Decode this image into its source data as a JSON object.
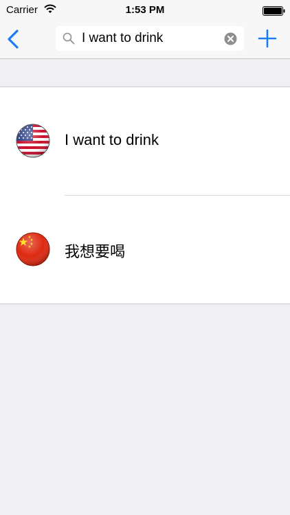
{
  "status_bar": {
    "carrier": "Carrier",
    "time": "1:53 PM",
    "wifi_icon": "wifi-icon",
    "battery_icon": "battery-icon"
  },
  "nav_bar": {
    "back_icon": "chevron-left-icon",
    "search": {
      "icon": "search-icon",
      "value": "I want to drink",
      "clear_icon": "clear-icon"
    },
    "add_icon": "plus-icon"
  },
  "phrases": [
    {
      "flag_icon": "us-flag-icon",
      "text": "I want to drink"
    },
    {
      "flag_icon": "china-flag-icon",
      "text": "我想要喝"
    }
  ],
  "colors": {
    "accent": "#1a7cf5",
    "background": "#efeff4",
    "bar": "#f7f7f7"
  }
}
